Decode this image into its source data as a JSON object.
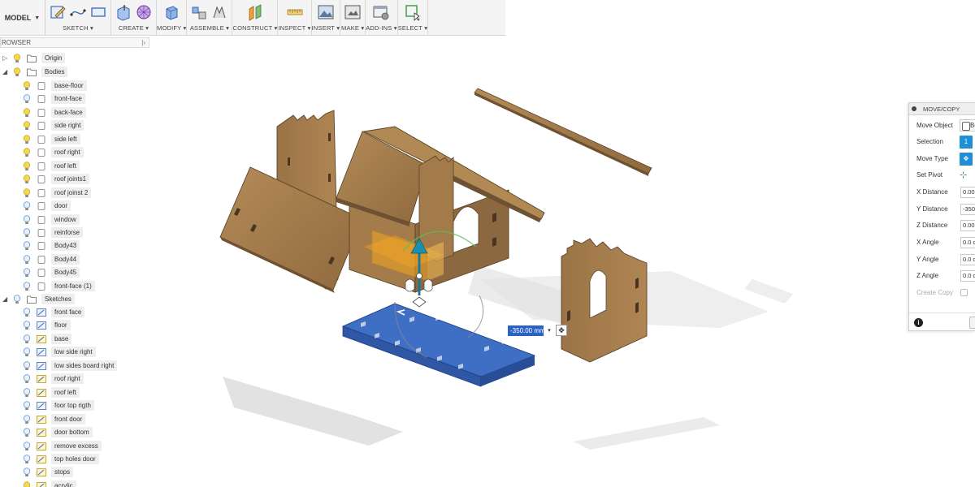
{
  "toolbar": {
    "workspace": "MODEL",
    "groups": [
      {
        "label": "SKETCH ▾"
      },
      {
        "label": "CREATE ▾"
      },
      {
        "label": "MODIFY ▾"
      },
      {
        "label": "ASSEMBLE ▾"
      },
      {
        "label": "CONSTRUCT ▾"
      },
      {
        "label": "INSPECT ▾"
      },
      {
        "label": "INSERT ▾"
      },
      {
        "label": "MAKE ▾"
      },
      {
        "label": "ADD-INS ▾"
      },
      {
        "label": "SELECT ▾"
      }
    ]
  },
  "browser": {
    "title": "ROWSER",
    "pin": "|›",
    "origin": "Origin",
    "bodies_label": "Bodies",
    "bodies": [
      "base-floor",
      "front-face",
      "back-face",
      "side right",
      "side left",
      "roof right",
      "roof left",
      "roof joints1",
      "roof joinst 2",
      "door",
      "window",
      "reinforse",
      "Body43",
      "Body44",
      "Body45",
      "front-face (1)"
    ],
    "sketches_label": "Sketches",
    "sketches": [
      "front face",
      "floor",
      "base",
      "low side right",
      "low sides board right",
      "roof right",
      "roof left",
      "foor top rigth",
      "front door",
      "door bottom",
      "remove excess",
      "top holes door",
      "stops",
      "acrylic"
    ]
  },
  "viewport": {
    "distance_value": "-350.00 mm",
    "dropdown": "▾",
    "pivot": "✥"
  },
  "move_panel": {
    "title": "MOVE/COPY",
    "rows": [
      {
        "label": "Move Object",
        "value": "Bo"
      },
      {
        "label": "Selection",
        "value": "1"
      },
      {
        "label": "Move Type",
        "value": "✥"
      },
      {
        "label": "Set Pivot",
        "value": "⊹"
      },
      {
        "label": "X Distance",
        "value": "0.00"
      },
      {
        "label": "Y Distance",
        "value": "-350"
      },
      {
        "label": "Z Distance",
        "value": "0.00"
      },
      {
        "label": "X Angle",
        "value": "0.0 d"
      },
      {
        "label": "Y Angle",
        "value": "0.0 d"
      },
      {
        "label": "Z Angle",
        "value": "0.0 d"
      },
      {
        "label": "Create Copy",
        "value": ""
      }
    ],
    "info": "i"
  },
  "colors": {
    "wood": "#a07a4c",
    "wood_dark": "#6e5233",
    "selected_body": "#3f6fc4",
    "highlight_orange": "#f5a623",
    "accent_blue": "#1f8fd6"
  }
}
